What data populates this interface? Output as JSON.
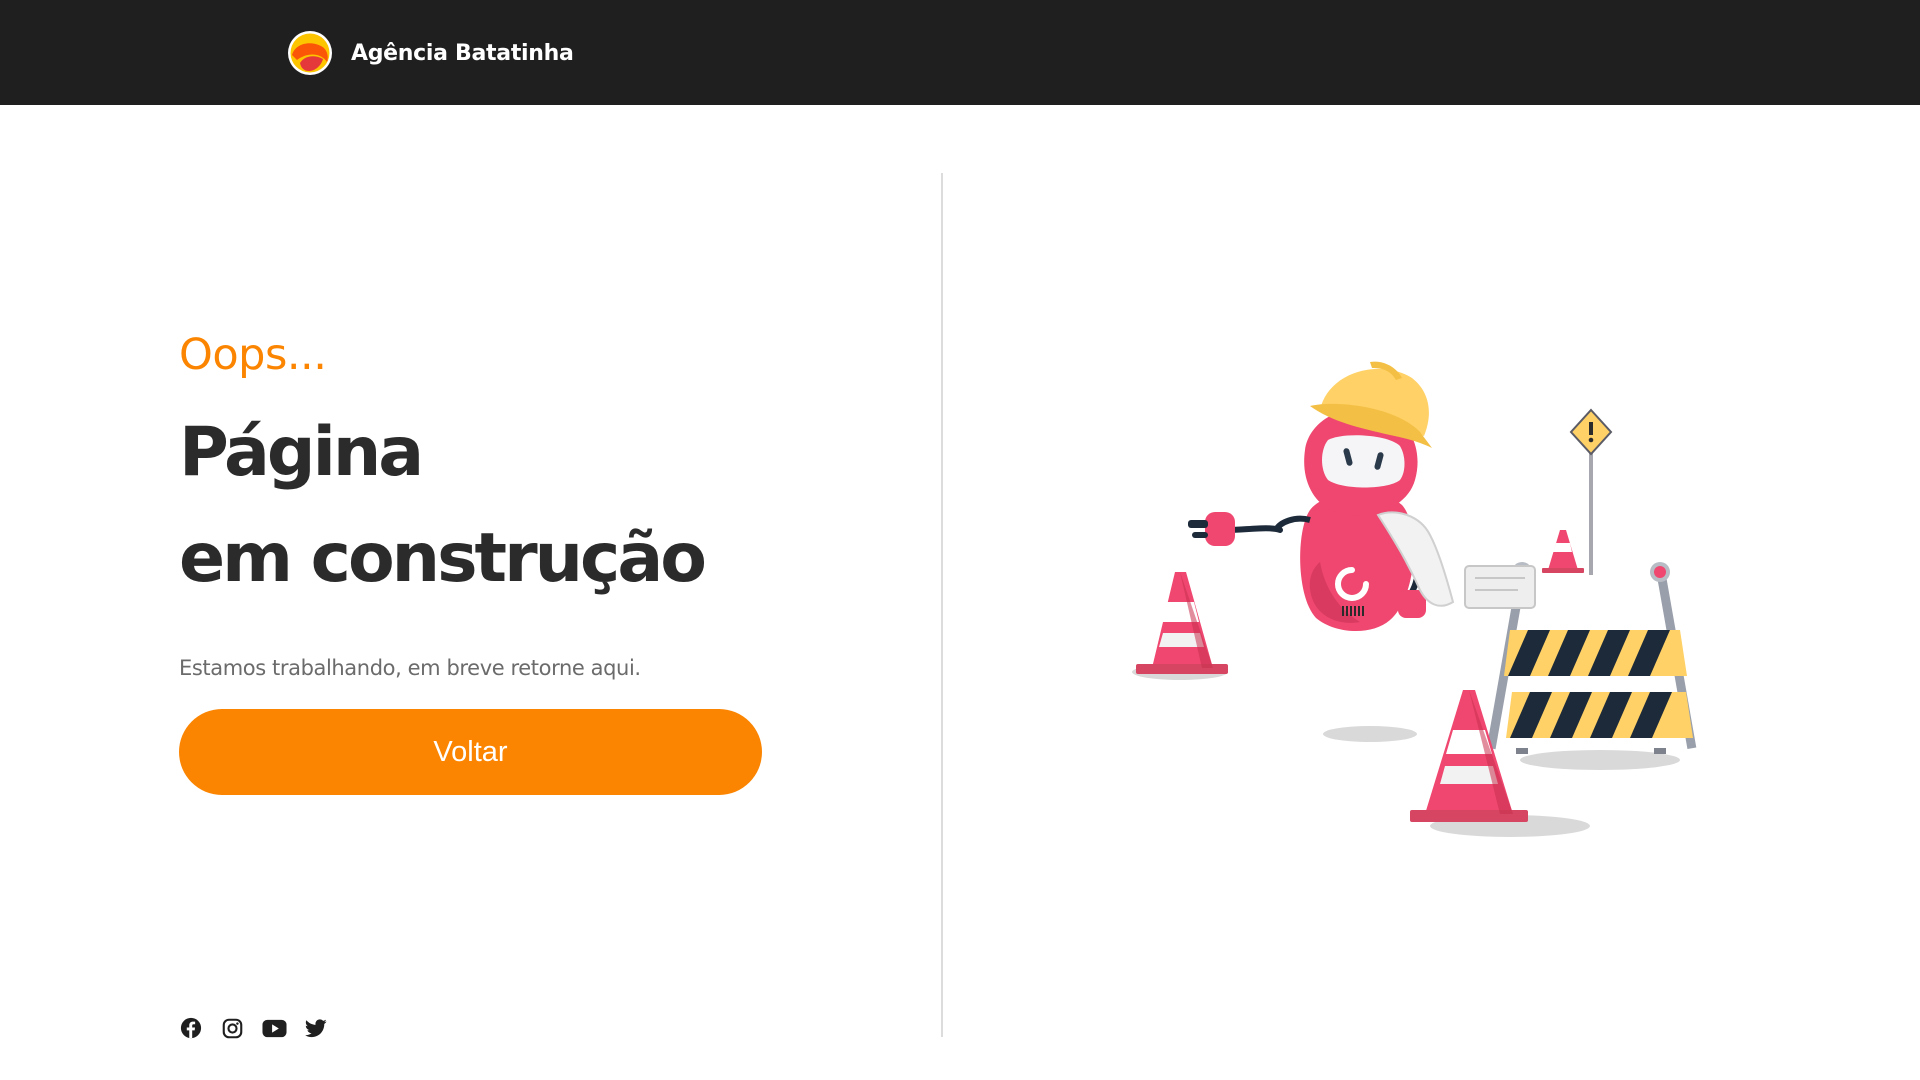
{
  "header": {
    "brand_name": "Agência Batatinha",
    "logo_icon": "batatinha-logo-icon",
    "background_color": "#1f1f1f"
  },
  "main": {
    "eyebrow": "Oops...",
    "headline_line1": "Página",
    "headline_line2": "em construção",
    "subtitle": "Estamos trabalhando, em breve retorne aqui.",
    "back_button_label": "Voltar",
    "accent_color": "#fb8500",
    "heading_color": "#2b2b2b"
  },
  "social": [
    {
      "icon": "facebook-icon"
    },
    {
      "icon": "instagram-icon"
    },
    {
      "icon": "youtube-icon"
    },
    {
      "icon": "twitter-icon"
    }
  ],
  "illustration": {
    "icon": "under-construction-robot-illustration"
  }
}
